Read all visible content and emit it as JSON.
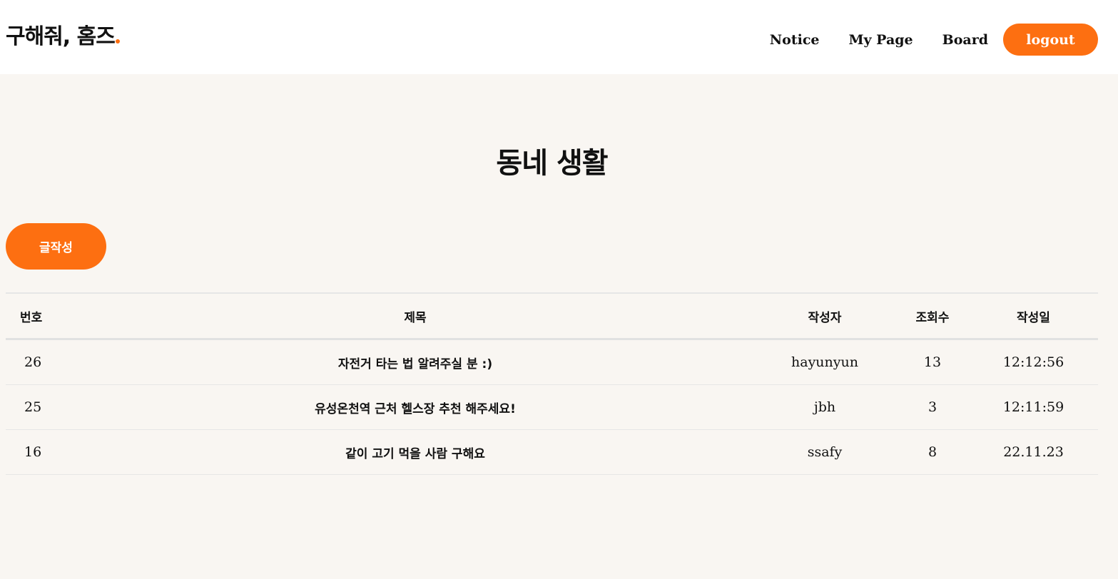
{
  "header": {
    "logo_text": "구해줘, 홈즈",
    "nav": {
      "notice": "Notice",
      "mypage": "My Page",
      "board": "Board",
      "logout": "logout"
    }
  },
  "main": {
    "title": "동네 생활",
    "write_button": "글작성",
    "table": {
      "headers": {
        "no": "번호",
        "title": "제목",
        "author": "작성자",
        "views": "조회수",
        "date": "작성일"
      },
      "rows": [
        {
          "no": "26",
          "title": "자전거 타는 법 알려주실 분 :)",
          "author": "hayunyun",
          "views": "13",
          "date": "12:12:56"
        },
        {
          "no": "25",
          "title": "유성온천역 근처 헬스장 추천 해주세요!",
          "author": "jbh",
          "views": "3",
          "date": "12:11:59"
        },
        {
          "no": "16",
          "title": "같이 고기 먹을 사람 구해요",
          "author": "ssafy",
          "views": "8",
          "date": "22.11.23"
        }
      ]
    }
  },
  "colors": {
    "accent": "#fd6f11",
    "background": "#f9f6f2",
    "header_bg": "#ffffff"
  }
}
